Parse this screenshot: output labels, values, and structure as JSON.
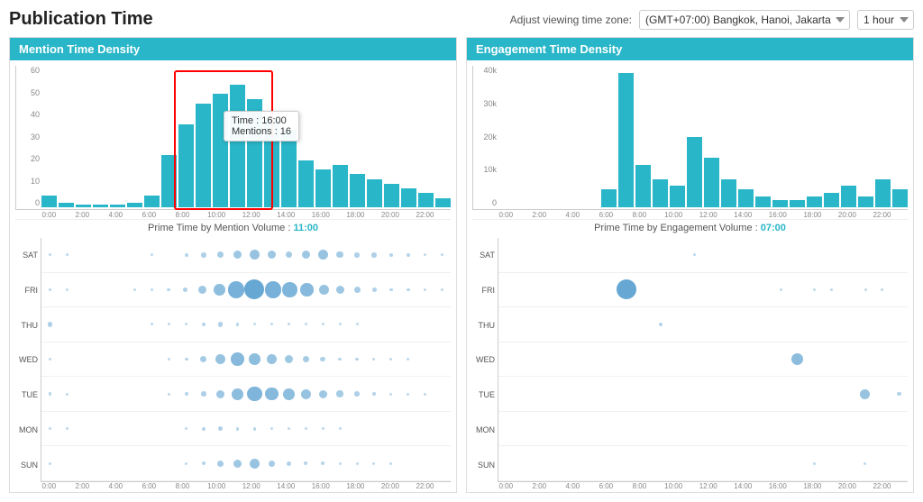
{
  "header": {
    "title": "Publication Time",
    "timezone_label": "Adjust viewing time zone:",
    "timezone_value": "(GMT+07:00) Bangkok, Hanoi, Jakarta",
    "hour_value": "1 hour"
  },
  "left_chart": {
    "title": "Mention Time Density",
    "prime_time_label": "Prime Time by Mention Volume : ",
    "prime_time_value": "11:00",
    "y_labels": [
      "0",
      "10",
      "20",
      "30",
      "40",
      "50",
      "60"
    ],
    "x_labels": [
      "0:00",
      "1:00",
      "2:00",
      "3:00",
      "4:00",
      "5:00",
      "6:00",
      "7:00",
      "8:00",
      "9:00",
      "10:00",
      "11:00",
      "12:00",
      "13:00",
      "14:00",
      "15:00",
      "16:00",
      "17:00",
      "18:00",
      "19:00",
      "20:00",
      "21:00",
      "22:00",
      "23:00"
    ],
    "bars": [
      5,
      2,
      1,
      1,
      1,
      2,
      5,
      22,
      35,
      44,
      48,
      52,
      46,
      38,
      33,
      20,
      16,
      18,
      14,
      12,
      10,
      8,
      6,
      4
    ],
    "tooltip": {
      "time_label": "Time : 16:00",
      "mention_label": "Mentions : 16"
    },
    "bubble_days": [
      "SAT",
      "FRI",
      "THU",
      "WED",
      "TUE",
      "MON",
      "SUN"
    ],
    "bubble_data": {
      "SAT": [
        1,
        1,
        0,
        0,
        0,
        0,
        1,
        0,
        2,
        3,
        4,
        5,
        6,
        5,
        4,
        5,
        6,
        4,
        3,
        3,
        2,
        2,
        1,
        1
      ],
      "FRI": [
        2,
        1,
        0,
        0,
        0,
        1,
        1,
        2,
        3,
        5,
        7,
        10,
        12,
        10,
        9,
        8,
        6,
        5,
        4,
        3,
        2,
        2,
        1,
        1
      ],
      "THU": [
        3,
        0,
        0,
        0,
        0,
        0,
        1,
        1,
        1,
        2,
        3,
        2,
        1,
        1,
        1,
        1,
        1,
        1,
        1,
        0,
        0,
        0,
        0,
        0
      ],
      "WED": [
        1,
        0,
        0,
        0,
        0,
        0,
        0,
        1,
        2,
        4,
        6,
        8,
        7,
        6,
        5,
        4,
        3,
        2,
        2,
        1,
        1,
        1,
        0,
        0
      ],
      "TUE": [
        2,
        1,
        0,
        0,
        0,
        0,
        0,
        1,
        2,
        3,
        5,
        7,
        9,
        8,
        7,
        6,
        5,
        4,
        3,
        2,
        1,
        1,
        1,
        0
      ],
      "MON": [
        1,
        1,
        0,
        0,
        0,
        0,
        0,
        0,
        1,
        2,
        3,
        2,
        2,
        1,
        1,
        1,
        1,
        1,
        0,
        0,
        0,
        0,
        0,
        0
      ],
      "SUN": [
        1,
        0,
        0,
        0,
        0,
        0,
        0,
        0,
        1,
        2,
        4,
        5,
        6,
        4,
        3,
        2,
        2,
        1,
        1,
        1,
        1,
        0,
        0,
        0
      ]
    }
  },
  "right_chart": {
    "title": "Engagement Time Density",
    "prime_time_label": "Prime Time by Engagement Volume : ",
    "prime_time_value": "07:00",
    "y_labels": [
      "0",
      "10k",
      "20k",
      "30k",
      "40k"
    ],
    "x_labels": [
      "0:00",
      "1:00",
      "2:00",
      "3:00",
      "4:00",
      "5:00",
      "6:00",
      "7:00",
      "8:00",
      "9:00",
      "10:00",
      "11:00",
      "12:00",
      "13:00",
      "14:00",
      "15:00",
      "16:00",
      "17:00",
      "18:00",
      "19:00",
      "20:00",
      "21:00",
      "22:00",
      "23:00"
    ],
    "bars": [
      0,
      0,
      0,
      0,
      0,
      0,
      5,
      38,
      12,
      8,
      6,
      20,
      14,
      8,
      5,
      3,
      2,
      2,
      3,
      4,
      6,
      3,
      8,
      5
    ],
    "bubble_days": [
      "SAT",
      "FRI",
      "THU",
      "WED",
      "TUE",
      "MON",
      "SUN"
    ],
    "bubble_data": {
      "SAT": [
        0,
        0,
        0,
        0,
        0,
        0,
        0,
        0,
        0,
        0,
        0,
        1,
        0,
        0,
        0,
        0,
        0,
        0,
        0,
        0,
        0,
        0,
        0,
        0
      ],
      "FRI": [
        0,
        0,
        0,
        0,
        0,
        0,
        0,
        10,
        0,
        0,
        0,
        0,
        0,
        0,
        0,
        0,
        1,
        0,
        1,
        1,
        0,
        1,
        1,
        0
      ],
      "THU": [
        0,
        0,
        0,
        0,
        0,
        0,
        0,
        0,
        0,
        2,
        0,
        0,
        0,
        0,
        0,
        0,
        0,
        0,
        0,
        0,
        0,
        0,
        0,
        0
      ],
      "WED": [
        0,
        0,
        0,
        0,
        0,
        0,
        0,
        0,
        0,
        0,
        0,
        0,
        0,
        0,
        0,
        0,
        0,
        6,
        0,
        0,
        0,
        0,
        0,
        0
      ],
      "TUE": [
        0,
        0,
        0,
        0,
        0,
        0,
        0,
        0,
        0,
        0,
        0,
        0,
        0,
        0,
        0,
        0,
        0,
        0,
        0,
        0,
        0,
        5,
        0,
        2
      ],
      "MON": [
        0,
        0,
        0,
        0,
        0,
        0,
        0,
        0,
        0,
        0,
        0,
        0,
        0,
        0,
        0,
        0,
        0,
        0,
        0,
        0,
        0,
        0,
        0,
        0
      ],
      "SUN": [
        0,
        0,
        0,
        0,
        0,
        0,
        0,
        0,
        0,
        0,
        0,
        0,
        0,
        0,
        0,
        0,
        0,
        0,
        1,
        0,
        0,
        1,
        0,
        0
      ]
    }
  }
}
